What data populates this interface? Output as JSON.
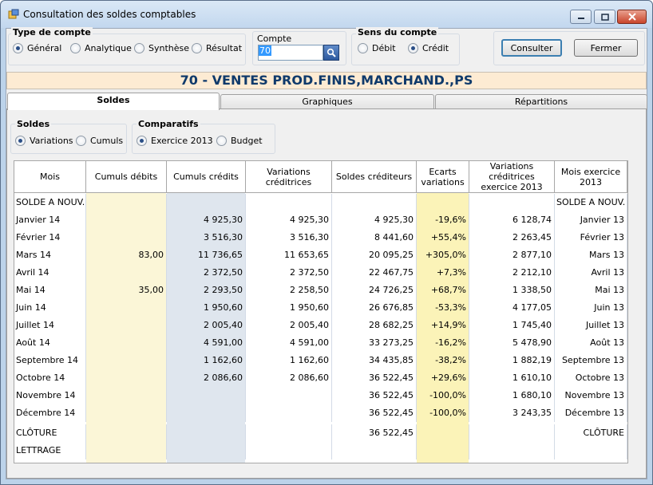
{
  "window": {
    "title": "Consultation des soldes comptables"
  },
  "type_compte": {
    "title": "Type de compte",
    "options": [
      "Général",
      "Analytique",
      "Synthèse",
      "Résultat"
    ],
    "selected": "Général"
  },
  "compte": {
    "label": "Compte",
    "value": "70"
  },
  "sens": {
    "title": "Sens du compte",
    "options": [
      "Débit",
      "Crédit"
    ],
    "selected": "Crédit"
  },
  "buttons": {
    "consulter": "Consulter",
    "fermer": "Fermer"
  },
  "banner": "70 - VENTES PROD.FINIS,MARCHAND.,PS",
  "tabs": [
    {
      "label": "Soldes",
      "active": true
    },
    {
      "label": "Graphiques",
      "active": false
    },
    {
      "label": "Répartitions",
      "active": false
    }
  ],
  "soldes_group": {
    "title": "Soldes",
    "options": [
      "Variations",
      "Cumuls"
    ],
    "selected": "Variations"
  },
  "comparatifs_group": {
    "title": "Comparatifs",
    "options": [
      "Exercice 2013",
      "Budget"
    ],
    "selected": "Exercice 2013"
  },
  "table": {
    "columns": [
      "Mois",
      "Cumuls débits",
      "Cumuls crédits",
      "Variations créditrices",
      "Soldes créditeurs",
      "Ecarts variations",
      "Variations créditrices exercice 2013",
      "Mois exercice 2013"
    ],
    "rows": [
      [
        "SOLDE A NOUV.",
        "",
        "",
        "",
        "",
        "",
        "",
        "SOLDE A NOUV."
      ],
      [
        "Janvier 14",
        "",
        "4 925,30",
        "4 925,30",
        "4 925,30",
        "-19,6%",
        "6 128,74",
        "Janvier 13"
      ],
      [
        "Février 14",
        "",
        "3 516,30",
        "3 516,30",
        "8 441,60",
        "+55,4%",
        "2 263,45",
        "Février 13"
      ],
      [
        "Mars 14",
        "83,00",
        "11 736,65",
        "11 653,65",
        "20 095,25",
        "+305,0%",
        "2 877,10",
        "Mars 13"
      ],
      [
        "Avril 14",
        "",
        "2 372,50",
        "2 372,50",
        "22 467,75",
        "+7,3%",
        "2 212,10",
        "Avril 13"
      ],
      [
        "Mai 14",
        "35,00",
        "2 293,50",
        "2 258,50",
        "24 726,25",
        "+68,7%",
        "1 338,50",
        "Mai 13"
      ],
      [
        "Juin 14",
        "",
        "1 950,60",
        "1 950,60",
        "26 676,85",
        "-53,3%",
        "4 177,05",
        "Juin 13"
      ],
      [
        "Juillet 14",
        "",
        "2 005,40",
        "2 005,40",
        "28 682,25",
        "+14,9%",
        "1 745,40",
        "Juillet 13"
      ],
      [
        "Août 14",
        "",
        "4 591,00",
        "4 591,00",
        "33 273,25",
        "-16,2%",
        "5 478,90",
        "Août 13"
      ],
      [
        "Septembre 14",
        "",
        "1 162,60",
        "1 162,60",
        "34 435,85",
        "-38,2%",
        "1 882,19",
        "Septembre 13"
      ],
      [
        "Octobre 14",
        "",
        "2 086,60",
        "2 086,60",
        "36 522,45",
        "+29,6%",
        "1 610,10",
        "Octobre 13"
      ],
      [
        "Novembre 14",
        "",
        "",
        "",
        "36 522,45",
        "-100,0%",
        "1 680,10",
        "Novembre 13"
      ],
      [
        "Décembre 14",
        "",
        "",
        "",
        "36 522,45",
        "-100,0%",
        "3 243,35",
        "Décembre 13"
      ],
      [
        "CLÔTURE",
        "",
        "",
        "",
        "36 522,45",
        "",
        "",
        "CLÔTURE"
      ],
      [
        "LETTRAGE",
        "",
        "",
        "",
        "",
        "",
        "",
        ""
      ]
    ]
  },
  "colors": {
    "debit_col": "#fbf6d7",
    "credit_col": "#dfe6ee",
    "ecart_col": "#fbf3b8",
    "banner_text": "#0f3a6b"
  }
}
